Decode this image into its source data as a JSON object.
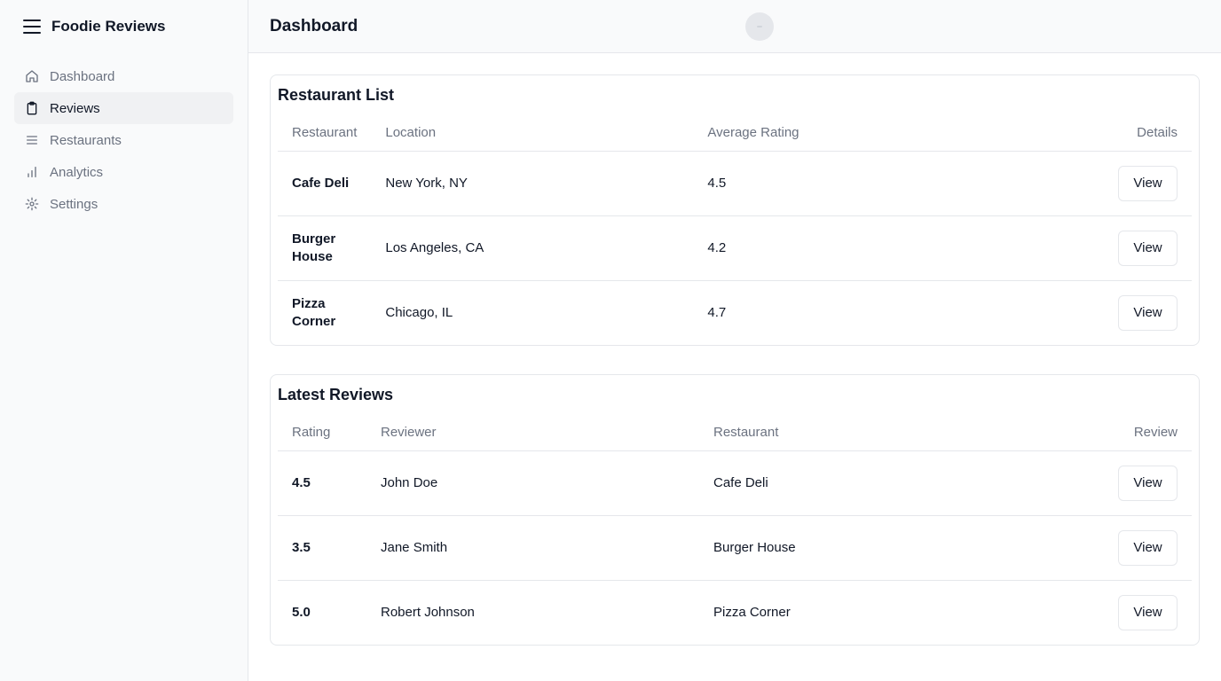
{
  "app": {
    "title": "Foodie Reviews"
  },
  "sidebar": {
    "items": [
      {
        "label": "Dashboard",
        "icon": "home-icon",
        "active": false
      },
      {
        "label": "Reviews",
        "icon": "clipboard-icon",
        "active": true
      },
      {
        "label": "Restaurants",
        "icon": "list-icon",
        "active": false
      },
      {
        "label": "Analytics",
        "icon": "bar-chart-icon",
        "active": false
      },
      {
        "label": "Settings",
        "icon": "gear-icon",
        "active": false
      }
    ]
  },
  "header": {
    "title": "Dashboard"
  },
  "restaurant_list": {
    "title": "Restaurant List",
    "columns": [
      "Restaurant",
      "Location",
      "Average Rating",
      "Details"
    ],
    "rows": [
      {
        "name": "Cafe Deli",
        "location": "New York, NY",
        "rating": "4.5",
        "action": "View"
      },
      {
        "name": "Burger House",
        "location": "Los Angeles, CA",
        "rating": "4.2",
        "action": "View"
      },
      {
        "name": "Pizza Corner",
        "location": "Chicago, IL",
        "rating": "4.7",
        "action": "View"
      }
    ]
  },
  "latest_reviews": {
    "title": "Latest Reviews",
    "columns": [
      "Rating",
      "Reviewer",
      "Restaurant",
      "Review"
    ],
    "rows": [
      {
        "rating": "4.5",
        "reviewer": "John Doe",
        "restaurant": "Cafe Deli",
        "action": "View"
      },
      {
        "rating": "3.5",
        "reviewer": "Jane Smith",
        "restaurant": "Burger House",
        "action": "View"
      },
      {
        "rating": "5.0",
        "reviewer": "Robert Johnson",
        "restaurant": "Pizza Corner",
        "action": "View"
      }
    ]
  }
}
